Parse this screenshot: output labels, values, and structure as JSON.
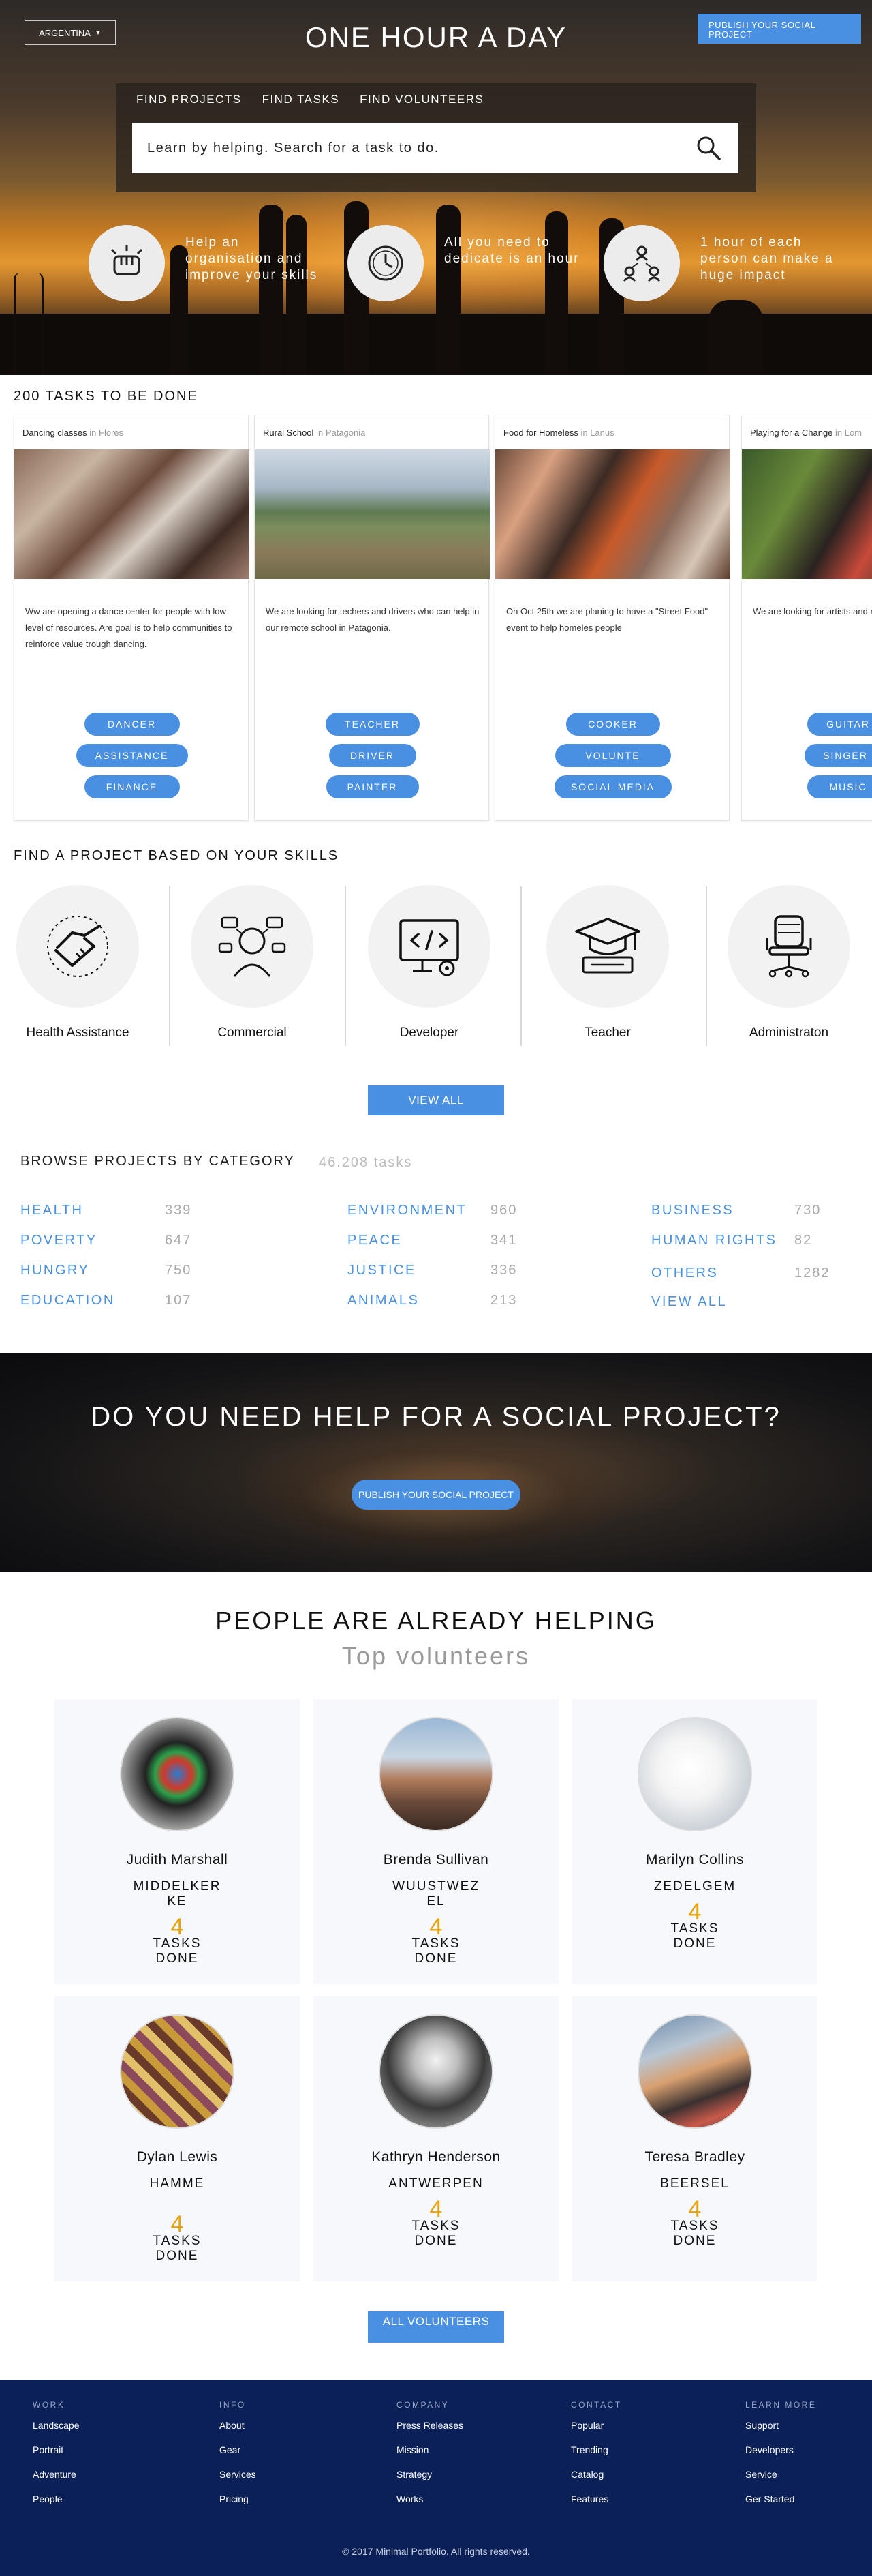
{
  "header": {
    "country": "ARGENTINA",
    "country_caret": "▼",
    "title": "ONE HOUR A DAY",
    "publish_label": "PUBLISH YOUR SOCIAL PROJECT",
    "tabs": [
      "FIND PROJECTS",
      "FIND TASKS",
      "FIND VOLUNTEERS"
    ],
    "search_value": "Learn by helping. Search for a task to do.",
    "features": [
      {
        "icon": "handshake-fist-icon",
        "text": "Help an organisation and improve your skills"
      },
      {
        "icon": "clock-icon",
        "text": "All you need to dedicate is an hour"
      },
      {
        "icon": "people-network-icon",
        "text": "1 hour of each person can make a huge impact"
      }
    ]
  },
  "tasks": {
    "title": "200 TASKS TO BE DONE",
    "cards": [
      {
        "name": "Dancing classes",
        "loc_prefix": "in",
        "location": "Flores",
        "description": "Ww are opening a dance center for people with low level of resources. Are goal is to help communities to reinforce value trough dancing.",
        "tags": [
          "DANCER",
          "ASSISTANCE",
          "FINANCE"
        ]
      },
      {
        "name": "Rural School",
        "loc_prefix": "in",
        "location": "Patagonia",
        "description": "We are looking for techers and drivers who can help in our remote school in Patagonia.",
        "tags": [
          "TEACHER",
          "DRIVER",
          "PAINTER"
        ]
      },
      {
        "name": "Food for Homeless",
        "loc_prefix": "in",
        "location": "Lanus",
        "description": "On  Oct 25th we are planing to have a \"Street Food\" event  to help homeles people",
        "tags": [
          "COOKER",
          "VOLUNTE",
          "SOCIAL MEDIA"
        ]
      },
      {
        "name": "Playing for a Change",
        "loc_prefix": "in",
        "location": "Lom",
        "description": "We are looking for artists and musicians to participate in our next so",
        "tags": [
          "GUITAR",
          "SINGER",
          "MUSIC"
        ]
      }
    ]
  },
  "skills": {
    "title": "FIND A PROJECT BASED ON YOUR SKILLS",
    "items": [
      {
        "label": "Health Assistance",
        "icon": "handshake-icon"
      },
      {
        "label": "Commercial",
        "icon": "salesperson-icon"
      },
      {
        "label": "Developer",
        "icon": "code-monitor-icon"
      },
      {
        "label": "Teacher",
        "icon": "graduation-cap-icon"
      },
      {
        "label": "Administraton",
        "icon": "office-chair-icon"
      }
    ],
    "view_all": "VIEW ALL"
  },
  "categories": {
    "title": "BROWSE PROJECTS BY CATEGORY",
    "count": "46.208 tasks",
    "columns": [
      [
        {
          "name": "HEALTH",
          "count": "339"
        },
        {
          "name": "POVERTY",
          "count": "647"
        },
        {
          "name": "HUNGRY",
          "count": "750"
        },
        {
          "name": "EDUCATION",
          "count": "107"
        }
      ],
      [
        {
          "name": "ENVIRONMENT",
          "count": "960"
        },
        {
          "name": "PEACE",
          "count": "341"
        },
        {
          "name": "JUSTICE",
          "count": "336"
        },
        {
          "name": "ANIMALS",
          "count": "213"
        }
      ],
      [
        {
          "name": "BUSINESS",
          "count": "730"
        },
        {
          "name": "HUMAN RIGHTS",
          "count": "82"
        },
        {
          "name": "OTHERS",
          "count": "1282"
        },
        {
          "name": "VIEW ALL",
          "count": ""
        }
      ]
    ]
  },
  "cta": {
    "title": "DO YOU NEED HELP FOR A SOCIAL PROJECT?",
    "button": "PUBLISH YOUR SOCIAL PROJECT"
  },
  "volunteers": {
    "title": "PEOPLE ARE ALREADY HELPING",
    "subtitle": "Top volunteers",
    "tasks_label": "TASKS DONE",
    "people": [
      {
        "name": "Judith Marshall",
        "city": "MIDDELKERKE",
        "tasks": "4"
      },
      {
        "name": "Brenda Sullivan",
        "city": "WUUSTWEZEL",
        "tasks": "4"
      },
      {
        "name": "Marilyn Collins",
        "city": "ZEDELGEM",
        "tasks": "4"
      },
      {
        "name": "Dylan Lewis",
        "city": "HAMME",
        "tasks": "4"
      },
      {
        "name": "Kathryn Henderson",
        "city": "ANTWERPEN",
        "tasks": "4"
      },
      {
        "name": "Teresa Bradley",
        "city": "BEERSEL",
        "tasks": "4"
      }
    ],
    "view_all": "ALL VOLUNTEERS"
  },
  "footer": {
    "columns": [
      {
        "heading": "WORK",
        "links": [
          "Landscape",
          "Portrait",
          "Adventure",
          "People"
        ]
      },
      {
        "heading": "INFO",
        "links": [
          "About",
          "Gear",
          "Services",
          "Pricing"
        ]
      },
      {
        "heading": "COMPANY",
        "links": [
          "Press Releases",
          "Mission",
          "Strategy",
          "Works"
        ]
      },
      {
        "heading": "CONTACT",
        "links": [
          "Popular",
          "Trending",
          "Catalog",
          "Features"
        ]
      },
      {
        "heading": "LEARN MORE",
        "links": [
          "Support",
          "Developers",
          "Service",
          "Ger Started"
        ]
      }
    ],
    "copyright": "© 2017 Minimal Portfolio. All rights reserved."
  },
  "colors": {
    "accent": "#4a90e2",
    "number": "#e7a30a",
    "footer": "#0a2057"
  }
}
